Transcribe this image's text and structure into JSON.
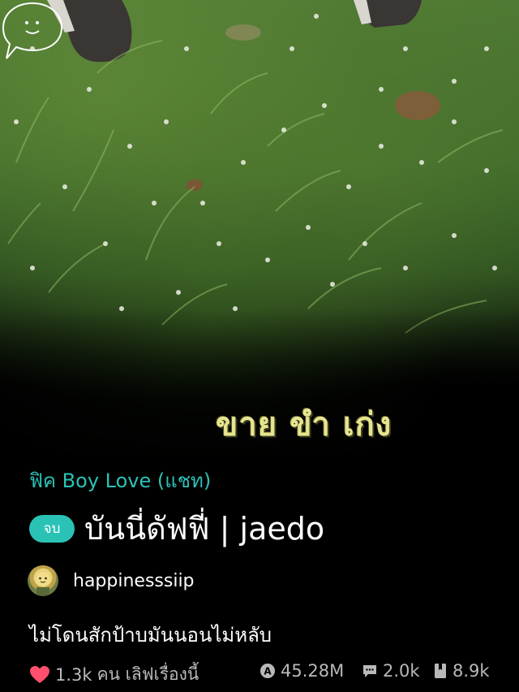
{
  "cover": {
    "caption": "ขาย ขำ เก่ง"
  },
  "story": {
    "genre": "ฟิค Boy Love (แชท)",
    "status_badge": "จบ",
    "title": "บันนี่ดัฟฟี่ | jaedo",
    "author": "happinesssiip",
    "synopsis": "ไม่โดนสักป้าบมันนอนไม่หลับ"
  },
  "stats": {
    "likes": "1.3k",
    "likes_suffix": "คน เลิฟเรื่องนี้",
    "views": "45.28M",
    "comments": "2.0k",
    "bookmarks": "8.9k"
  },
  "colors": {
    "accent": "#2bc2b6",
    "heart": "#ff4f6e",
    "muted": "#b9b9b9"
  },
  "icons": [
    "heart-icon",
    "views-icon",
    "comment-icon",
    "bookmark-icon",
    "speech-bubble-icon"
  ]
}
